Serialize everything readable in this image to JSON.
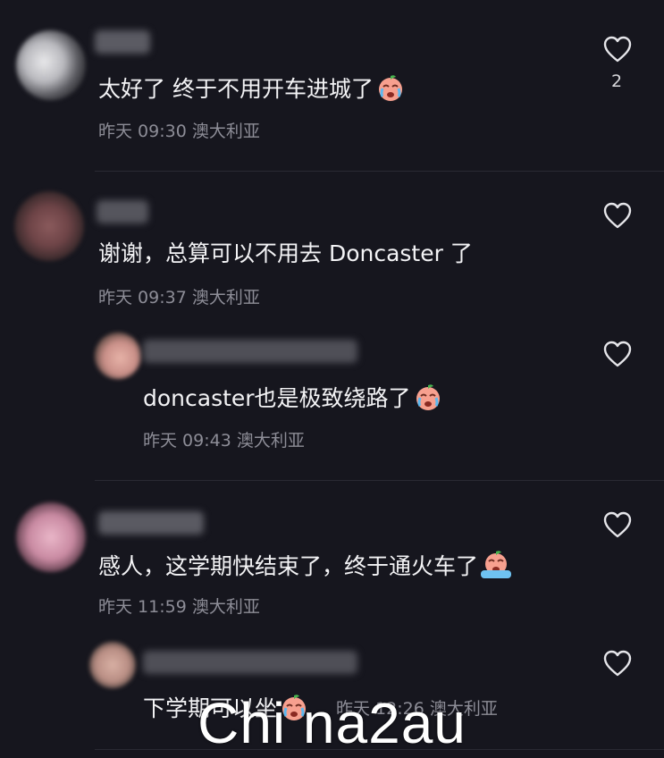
{
  "comments": [
    {
      "text": "太好了 终于不用开车进城了",
      "emoji": "crying-face",
      "meta": "昨天 09:30 澳大利亚",
      "likes": "2"
    },
    {
      "text": "谢谢，总算可以不用去 Doncaster 了",
      "meta": "昨天 09:37 澳大利亚",
      "reply": {
        "text": "doncaster也是极致绕路了",
        "emoji": "crying-face",
        "meta": "昨天 09:43 澳大利亚"
      }
    },
    {
      "text": "感人，这学期快结束了，终于通火车了",
      "emoji": "loudly-crying-face",
      "meta": "昨天 11:59 澳大利亚",
      "reply": {
        "text": "下学期可以坐",
        "emoji": "crying-face",
        "meta": "昨天 12:26 澳大利亚"
      }
    }
  ],
  "watermark": "Chi na2au",
  "colors": {
    "background": "#16161e",
    "text": "#f3f3f5",
    "meta": "#8d8d97"
  }
}
